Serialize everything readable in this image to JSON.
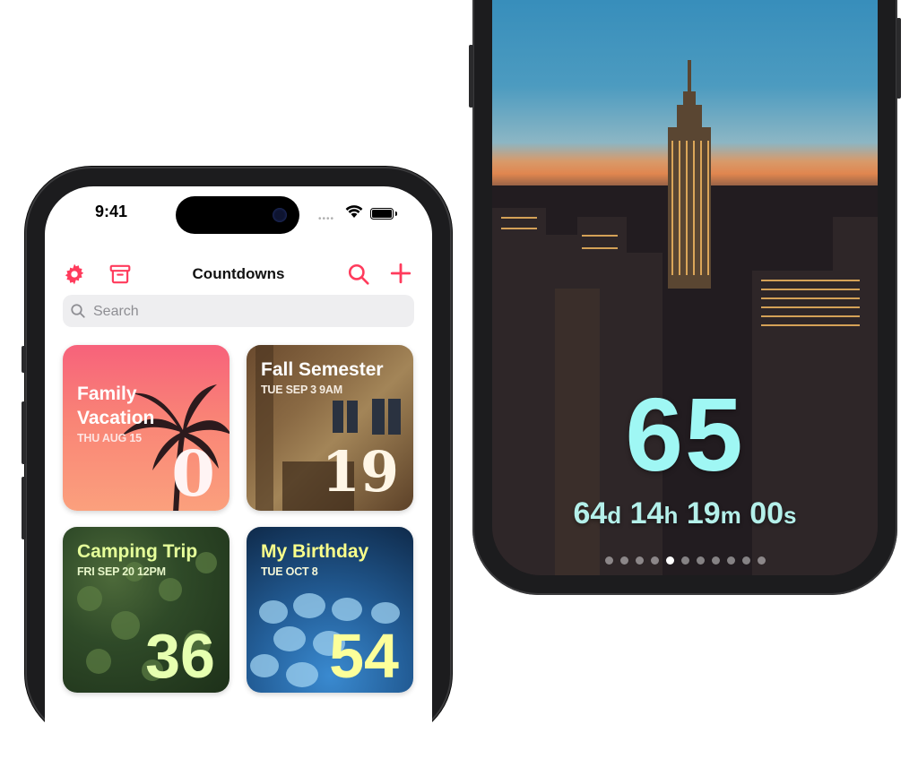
{
  "left_phone": {
    "status": {
      "time": "9:41",
      "signal": "••••"
    },
    "nav": {
      "title": "Countdowns",
      "icons": [
        "gear-icon",
        "archive-icon",
        "search-icon",
        "plus-icon"
      ],
      "accent_color": "#ff3b5c"
    },
    "search": {
      "placeholder": "Search"
    },
    "cards": [
      {
        "title": "Family\nVacation",
        "date": "THU AUG 15",
        "number": "0",
        "title_color": "#ffffff",
        "number_color": "#ffffff"
      },
      {
        "title": "Fall Semester",
        "date": "TUE SEP 3 9AM",
        "number": "19",
        "title_color": "#ffffff",
        "number_color": "#fff6e6"
      },
      {
        "title": "Camping Trip",
        "date": "FRI SEP 20 12PM",
        "number": "36",
        "title_color": "#e6ff9a",
        "number_color": "#e6ffb0"
      },
      {
        "title": "My Birthday",
        "date": "TUE OCT 8",
        "number": "54",
        "title_color": "#faff8a",
        "number_color": "#fcff9a"
      }
    ]
  },
  "right_phone": {
    "countdown_days": "65",
    "detail": {
      "days": "64",
      "days_unit": "d",
      "hours": "14",
      "hours_unit": "h",
      "minutes": "19",
      "minutes_unit": "m",
      "seconds": "00",
      "seconds_unit": "s"
    },
    "page_indicator": {
      "count": 11,
      "active": 4
    },
    "colors": {
      "big_number": "#9ff7f4"
    }
  }
}
